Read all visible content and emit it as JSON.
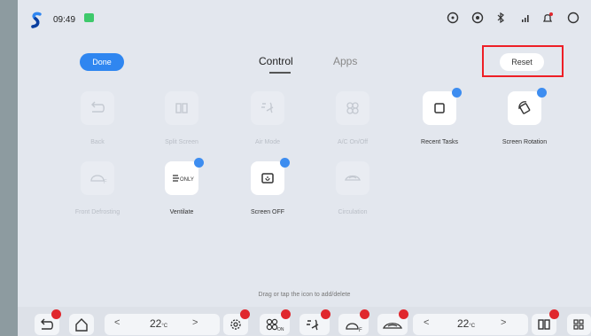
{
  "status_bar": {
    "time": "09:49",
    "icons": [
      "app-logo-icon",
      "notification-green-icon",
      "steering-wheel-icon",
      "location-icon",
      "bluetooth-icon",
      "signal-icon",
      "bell-icon",
      "face-icon"
    ]
  },
  "header": {
    "done_label": "Done",
    "tabs": [
      {
        "label": "Control",
        "active": true
      },
      {
        "label": "Apps",
        "active": false
      }
    ],
    "reset_label": "Reset"
  },
  "controls": [
    {
      "label": "Back",
      "icon": "back-icon",
      "active": false
    },
    {
      "label": "Split Screen",
      "icon": "split-screen-icon",
      "active": false
    },
    {
      "label": "Air Mode",
      "icon": "air-mode-icon",
      "active": false
    },
    {
      "label": "A/C On/Off",
      "icon": "ac-fan-icon",
      "active": false
    },
    {
      "label": "Recent Tasks",
      "icon": "recent-tasks-icon",
      "active": true
    },
    {
      "label": "Screen Rotation",
      "icon": "screen-rotation-icon",
      "active": true
    },
    {
      "label": "Front Defrosting",
      "icon": "front-defrost-icon",
      "active": false
    },
    {
      "label": "Ventilate",
      "icon": "ventilate-icon",
      "active": true,
      "badge_text": "ONLY"
    },
    {
      "label": "Screen OFF",
      "icon": "screen-off-icon",
      "active": true
    },
    {
      "label": "Circulation",
      "icon": "circulation-icon",
      "active": false
    }
  ],
  "hint": "Drag or tap the icon to add/delete",
  "dock": {
    "left_temp": "22",
    "right_temp": "22",
    "temp_unit": "°C",
    "left_arrow": "<",
    "right_arrow": ">",
    "fan_label": "ON",
    "defrost_label": "F",
    "colors": {
      "accent": "#2f86f0",
      "remove": "#e0272d",
      "highlight": "#ee1f26"
    }
  }
}
